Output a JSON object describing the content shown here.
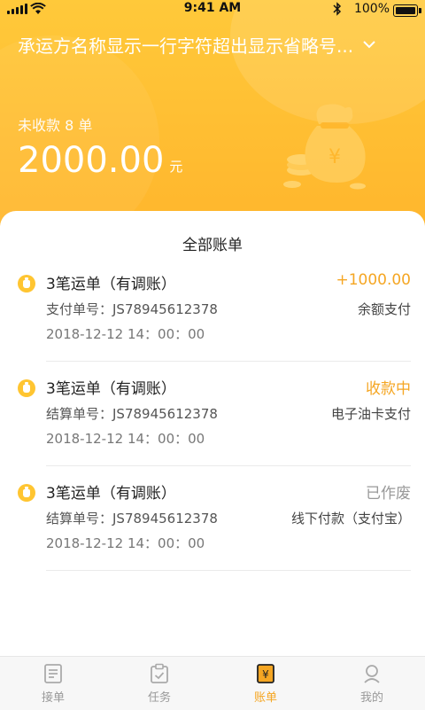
{
  "status_bar": {
    "time": "9:41 AM",
    "battery": "100%"
  },
  "header": {
    "carrier_name": "承运方名称显示一行字符超出显示省略号...",
    "unpaid_label": "未收款 8 单",
    "amount": "2000.00",
    "amount_unit": "元"
  },
  "section_title": "全部账单",
  "records": [
    {
      "title": "3笔运单（有调账）",
      "status": "+1000.00",
      "status_color": "#F5A623",
      "number_label": "支付单号：JS78945612378",
      "pay_method": "余额支付",
      "datetime": "2018-12-12  14：00：00"
    },
    {
      "title": "3笔运单（有调账）",
      "status": "收款中",
      "status_color": "#F5A623",
      "number_label": "结算单号：JS78945612378",
      "pay_method": "电子油卡支付",
      "datetime": "2018-12-12  14：00：00"
    },
    {
      "title": "3笔运单（有调账）",
      "status": "已作废",
      "status_color": "#999999",
      "number_label": "结算单号：JS78945612378",
      "pay_method": "线下付款（支付宝）",
      "datetime": "2018-12-12  14：00：00"
    }
  ],
  "tabs": [
    {
      "label": "接单",
      "icon": "list-icon",
      "active": false
    },
    {
      "label": "任务",
      "icon": "clipboard-check-icon",
      "active": false
    },
    {
      "label": "账单",
      "icon": "bill-yen-icon",
      "active": true
    },
    {
      "label": "我的",
      "icon": "user-icon",
      "active": false
    }
  ],
  "colors": {
    "accent": "#F5A623",
    "header_bg": "#FFC03A"
  }
}
